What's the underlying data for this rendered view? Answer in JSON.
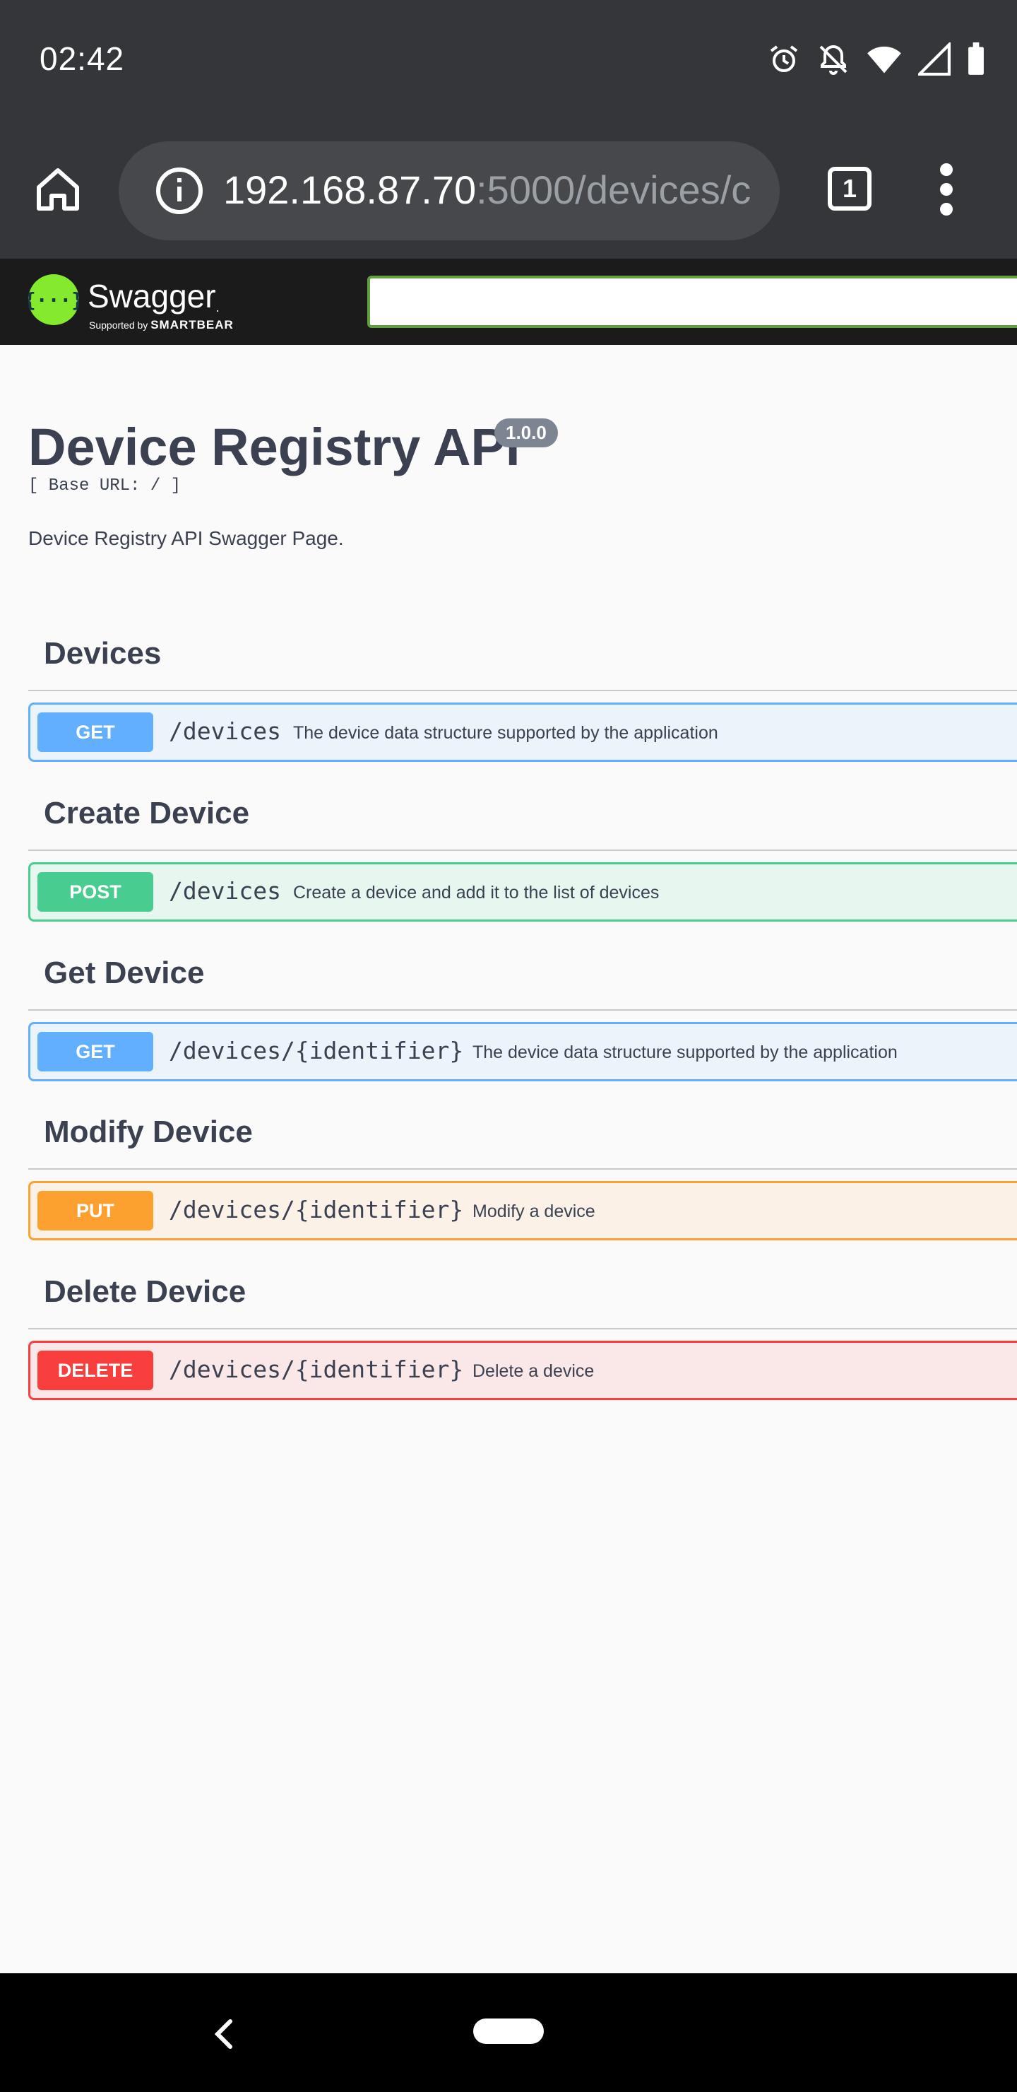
{
  "status_bar": {
    "time": "02:42",
    "icons": [
      "alarm-icon",
      "notifications-off-icon",
      "wifi-icon",
      "signal-icon",
      "battery-icon"
    ]
  },
  "browser": {
    "url_host": "192.168.87.70",
    "url_rest": ":5000/devices/c",
    "tab_count": "1"
  },
  "swagger": {
    "brand": "Swagger",
    "supported_by": "Supported by",
    "smartbear": "SMARTBEAR",
    "search_value": "",
    "accent_color": "#85ea2d"
  },
  "api": {
    "title": "Device Registry API",
    "version": "1.0.0",
    "base_url": "[ Base URL: / ]",
    "description": "Device Registry API Swagger Page."
  },
  "sections": [
    {
      "tag": "Devices",
      "op": {
        "method": "GET",
        "path": "/devices",
        "summary": "The device data structure supported by the application",
        "color": "#61affe"
      }
    },
    {
      "tag": "Create Device",
      "op": {
        "method": "POST",
        "path": "/devices",
        "summary": "Create a device and add it to the list of devices",
        "color": "#49cc90"
      }
    },
    {
      "tag": "Get Device",
      "op": {
        "method": "GET",
        "path": "/devices/{identifier}",
        "summary": "The device data structure supported by the application",
        "color": "#61affe"
      }
    },
    {
      "tag": "Modify Device",
      "op": {
        "method": "PUT",
        "path": "/devices/{identifier}",
        "summary": "Modify a device",
        "color": "#fca130"
      }
    },
    {
      "tag": "Delete Device",
      "op": {
        "method": "DELETE",
        "path": "/devices/{identifier}",
        "summary": "Delete a device",
        "color": "#f93e3e"
      }
    }
  ]
}
